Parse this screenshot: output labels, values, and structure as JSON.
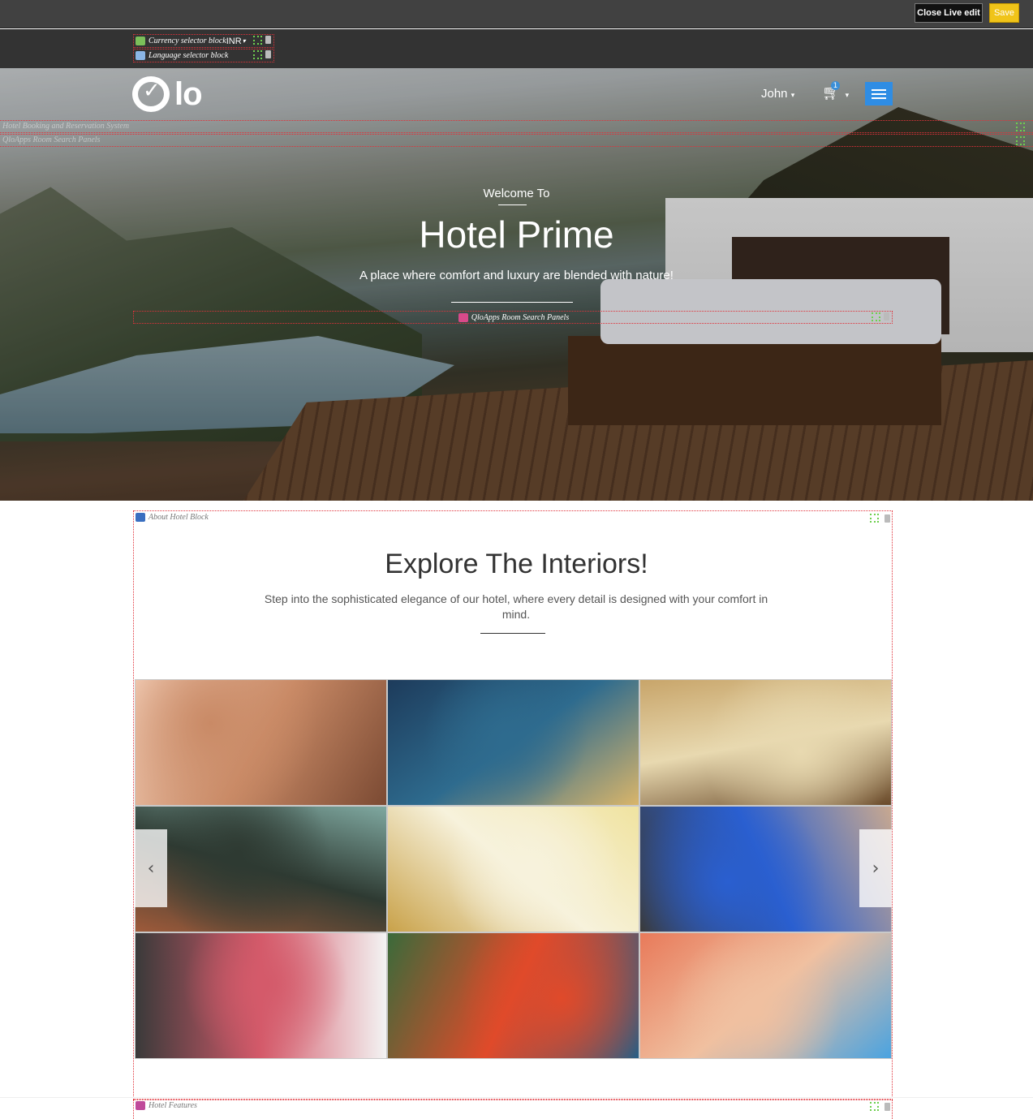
{
  "topbar": {
    "close_label": "Close Live edit",
    "save_label": "Save",
    "save_color": "#f0c419"
  },
  "liveedit": {
    "currency_block": "Currency selector block",
    "currency_value": "INR",
    "language_block": "Language selector block",
    "hotel_booking_strip": "Hotel Booking and Reservation System",
    "search_panels_strip": "QloApps Room Search Panels",
    "room_search_panel": "QloApps Room Search Panels",
    "about_block": "About Hotel Block",
    "features_block": "Hotel Features"
  },
  "header": {
    "logo": "Qlo",
    "user_name": "John",
    "cart_count": "1",
    "accent": "#2f8de4"
  },
  "hero": {
    "welcome": "Welcome To",
    "title": "Hotel Prime",
    "tagline": "A place where comfort and luxury are blended with nature!"
  },
  "about": {
    "title": "Explore The Interiors!",
    "description": "Step into the sophisticated elegance of our hotel, where every detail is designed with your comfort in mind.",
    "gallery": [
      {
        "name": "sunset-window",
        "colors": [
          "#f6d3bd",
          "#c98a66",
          "#7b4a33"
        ]
      },
      {
        "name": "pool-terrace-night",
        "colors": [
          "#1d3b5b",
          "#2e6b8e",
          "#d9b56a"
        ]
      },
      {
        "name": "chef-chopping",
        "colors": [
          "#c8a56a",
          "#e8d9b0",
          "#6a4a2a"
        ]
      },
      {
        "name": "gym-room",
        "colors": [
          "#7fa8a0",
          "#2e3a32",
          "#9e5a3a"
        ]
      },
      {
        "name": "yellow-bedroom",
        "colors": [
          "#f0e3a0",
          "#f7f2dc",
          "#c9a24a"
        ]
      },
      {
        "name": "rooftop-pool-city",
        "colors": [
          "#c8a890",
          "#2a5fd0",
          "#3a3a3a"
        ]
      },
      {
        "name": "canopy-bed",
        "colors": [
          "#f3f3f3",
          "#d45a6a",
          "#3a3a3a"
        ]
      },
      {
        "name": "tropical-pool-lounge",
        "colors": [
          "#1c5f8a",
          "#e04a2a",
          "#3a6a3a"
        ]
      },
      {
        "name": "resort-pool",
        "colors": [
          "#4aa3e0",
          "#f0c0a0",
          "#e87a5a"
        ]
      }
    ],
    "prev_icon": "chevron-left-icon",
    "next_icon": "chevron-right-icon"
  }
}
